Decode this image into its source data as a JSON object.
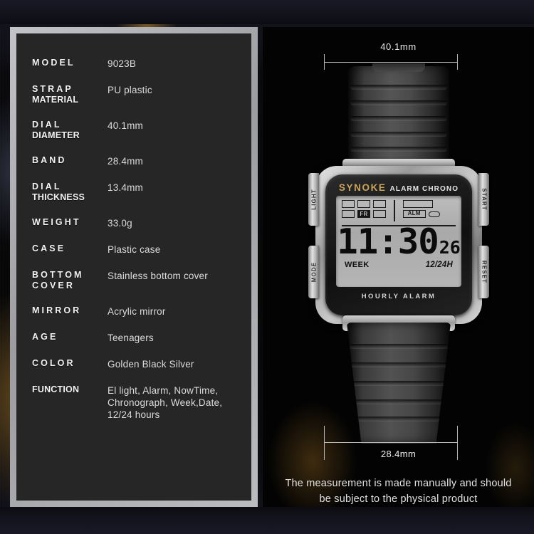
{
  "spec_panel": {
    "rows": [
      {
        "label": "MODEL",
        "label2": "",
        "value": [
          "9023B"
        ]
      },
      {
        "label": "STRAP",
        "label2": "MATERIAL",
        "value": [
          "PU plastic"
        ]
      },
      {
        "label": "DIAL",
        "label2": "DIAMETER",
        "value": [
          "40.1mm"
        ]
      },
      {
        "label": "BAND",
        "label2": "",
        "value": [
          "28.4mm"
        ]
      },
      {
        "label": "DIAL",
        "label2": "THICKNESS",
        "value": [
          "13.4mm"
        ]
      },
      {
        "label": "WEIGHT",
        "label2": "",
        "value": [
          "33.0g"
        ]
      },
      {
        "label": "CASE",
        "label2": "",
        "value": [
          "Plastic case"
        ]
      },
      {
        "label": "BOTTOM",
        "label2": "COVER",
        "value": [
          "Stainless bottom cover"
        ]
      },
      {
        "label": "MIRROR",
        "label2": "",
        "value": [
          "Acrylic mirror"
        ]
      },
      {
        "label": "AGE",
        "label2": "",
        "value": [
          "Teenagers"
        ]
      },
      {
        "label": "COLOR",
        "label2": "",
        "value": [
          "Golden  Black  Silver"
        ]
      },
      {
        "label": "FUNCTION",
        "label2": "",
        "value": [
          "El light,  Alarm,  NowTime,",
          "Chronograph,  Week,Date,",
          "12/24 hours"
        ]
      }
    ]
  },
  "photo_panel": {
    "dimension_top": "40.1mm",
    "dimension_bottom": "28.4mm",
    "caption_line1": "The measurement is made manually and should",
    "caption_line2": "be subject to the physical product"
  },
  "watch": {
    "brand": "SYNOKE",
    "brand_sub": "ALARM CHRONO",
    "bottom_text": "HOURLY ALARM",
    "buttons": {
      "left_top": "LIGHT",
      "left_bottom": "MODE",
      "right_top": "START",
      "right_bottom": "RESET"
    },
    "lcd": {
      "day_indicator": "FR",
      "alarm_indicator": "ALM",
      "time": "11:30",
      "seconds": "26",
      "week_label": "WEEK",
      "format_label": "12/24H"
    }
  },
  "colors": {
    "brand_gold": "#c9a45a",
    "panel_dark": "#262626",
    "frame_silver": "#b0b2b5",
    "lcd_gray": "#b3b3b3"
  }
}
